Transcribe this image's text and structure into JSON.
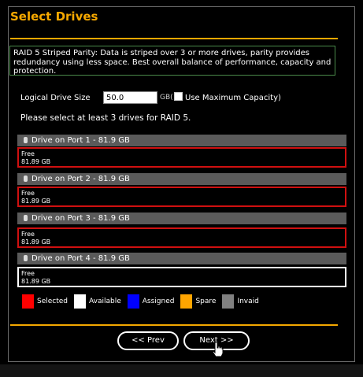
{
  "page": {
    "title": "Select Drives",
    "description": "RAID 5 Striped Parity: Data is striped over 3 or more drives, parity provides redundancy using less space. Best overall balance of performance, capacity and protection.",
    "logical_size_label": "Logical Drive Size",
    "logical_size_value": "50.0",
    "gb_label": "GB(",
    "max_capacity_label": "Use Maximum Capacity)",
    "instruction": "Please select at least 3 drives for RAID 5."
  },
  "drives": [
    {
      "header": "Drive on Port 1 - 81.9 GB",
      "status": "Free",
      "size": "81.89 GB",
      "state": "selected"
    },
    {
      "header": "Drive on Port 2 - 81.9 GB",
      "status": "Free",
      "size": "81.89 GB",
      "state": "selected"
    },
    {
      "header": "Drive on Port 3 - 81.9 GB",
      "status": "Free",
      "size": "81.89 GB",
      "state": "selected"
    },
    {
      "header": "Drive on Port 4 - 81.9 GB",
      "status": "Free",
      "size": "81.89 GB",
      "state": "available"
    }
  ],
  "legend": [
    {
      "label": "Selected",
      "color": "#ff0000"
    },
    {
      "label": "Available",
      "color": "#ffffff"
    },
    {
      "label": "Assigned",
      "color": "#0000ff"
    },
    {
      "label": "Spare",
      "color": "#ffa500"
    },
    {
      "label": "Invaid",
      "color": "#808080"
    }
  ],
  "buttons": {
    "prev": "<< Prev",
    "next": "Next >>"
  },
  "colors": {
    "accent": "#f5a800",
    "selected_border": "#d01010",
    "available_border": "#ffffff"
  }
}
